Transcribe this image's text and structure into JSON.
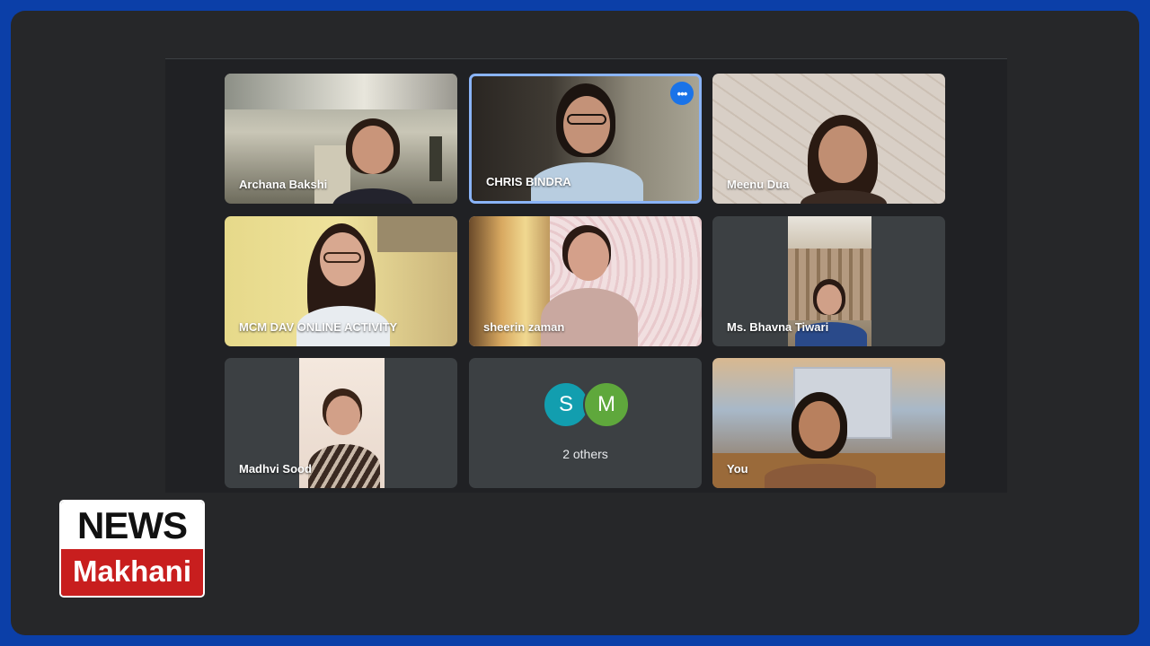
{
  "participants": [
    {
      "name": "Archana Bakshi"
    },
    {
      "name": "CHRIS BINDRA"
    },
    {
      "name": "Meenu Dua"
    },
    {
      "name": "MCM DAV ONLINE ACTIVITY"
    },
    {
      "name": "sheerin zaman"
    },
    {
      "name": "Ms. Bhavna Tiwari"
    },
    {
      "name": "Madhvi Sood"
    },
    {
      "name": "You"
    }
  ],
  "others_tile": {
    "avatars": [
      {
        "initial": "S",
        "color": "#129eaf"
      },
      {
        "initial": "M",
        "color": "#5fa83c"
      }
    ],
    "label": "2 others"
  },
  "more_options_icon": "more-horizontal-icon",
  "more_options_glyph": "•••",
  "logo": {
    "top": "NEWS",
    "bottom": "Makhani"
  },
  "colors": {
    "accent": "#8ab4f8",
    "button": "#1a73e8",
    "background": "#202124",
    "border": "#0b3fa8",
    "logo_red": "#c81e1e"
  }
}
